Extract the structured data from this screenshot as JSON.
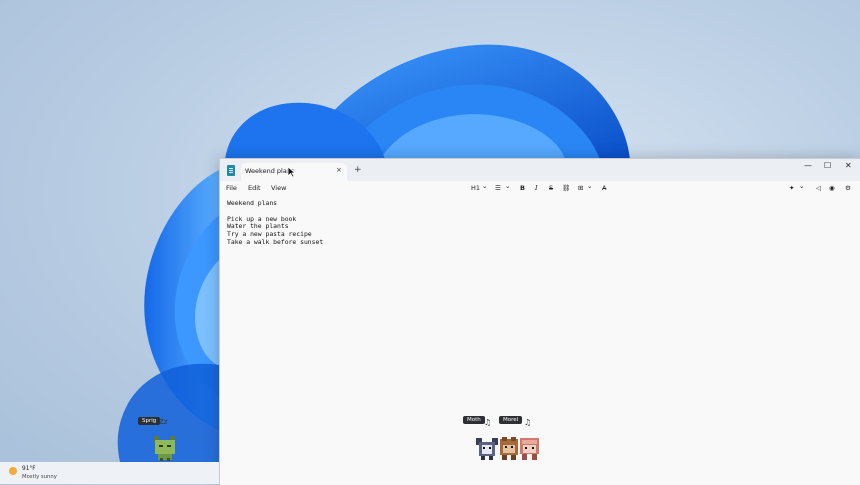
{
  "window": {
    "tab_title": "Weekend plans",
    "tab_close": "×",
    "new_tab": "+",
    "minimize": "—",
    "maximize": "☐",
    "close": "✕"
  },
  "menu": {
    "file": "File",
    "edit": "Edit",
    "view": "View"
  },
  "toolbar": {
    "heading": "H1",
    "list_icon": "☰",
    "bold": "B",
    "italic": "I",
    "strike": "S",
    "link_icon": "⛓",
    "table_icon": "⊞",
    "clear_format_icon": "A̶",
    "chevron": "⌄",
    "copilot_icon": "✦",
    "share_icon": "◁",
    "profile_icon": "◉",
    "settings_icon": "⚙"
  },
  "document": {
    "lines": [
      "Weekend plans",
      "",
      "Pick up a new book",
      "Water the plants",
      "Try a new pasta recipe",
      "Take a walk before sunset"
    ]
  },
  "taskbar": {
    "weather": {
      "temp": "91°F",
      "condition": "Mostly sunny"
    }
  },
  "pets": {
    "sprig": {
      "name": "Sprig",
      "status": "Zz"
    },
    "moth": {
      "name": "Moth",
      "note": "♫"
    },
    "morel": {
      "name": "Morel",
      "note": "♫"
    }
  },
  "colors": {
    "accent_blue": "#1a6fe0",
    "wallpaper_bg": "#b9cde3"
  }
}
